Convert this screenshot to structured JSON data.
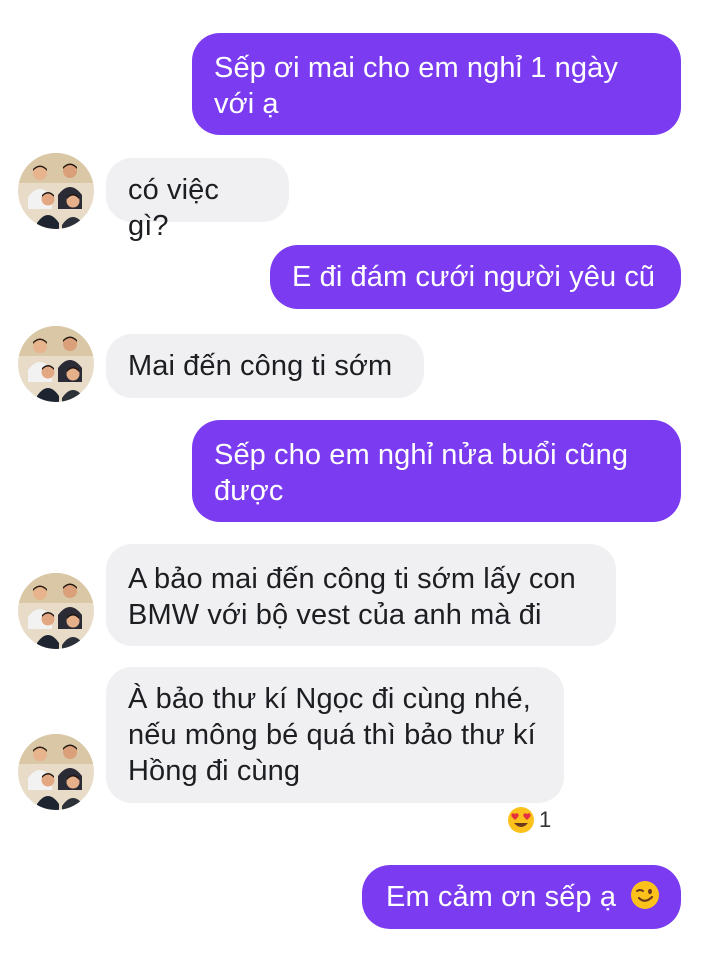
{
  "conversation": {
    "messages": [
      {
        "direction": "sent",
        "text": "Sếp ơi mai cho em nghỉ 1 ngày với ạ"
      },
      {
        "direction": "received",
        "text": "có việc gì?"
      },
      {
        "direction": "sent",
        "text": "E đi đám cưới người yêu cũ"
      },
      {
        "direction": "received",
        "text": "Mai đến công ti sớm"
      },
      {
        "direction": "sent",
        "text": "Sếp cho em nghỉ nửa buổi cũng được"
      },
      {
        "direction": "received",
        "text": "A bảo mai đến công ti sớm lấy con BMW với bộ vest của anh mà đi"
      },
      {
        "direction": "received",
        "text": "À bảo thư kí Ngọc đi cùng nhé, nếu mông bé quá thì bảo thư kí Hồng đi cùng"
      },
      {
        "direction": "sent",
        "text": "Em cảm ơn sếp ạ",
        "emoji": "winking-smile-emoji"
      }
    ],
    "reaction": {
      "emoji": "heart-eyes-emoji",
      "count": "1"
    },
    "avatar_icon": "group-photo-avatar",
    "colors": {
      "sent_bubble": "#7b3bf0",
      "sent_text": "#ffffff",
      "received_bubble": "#f0f0f3",
      "received_text": "#1c1e21"
    }
  }
}
